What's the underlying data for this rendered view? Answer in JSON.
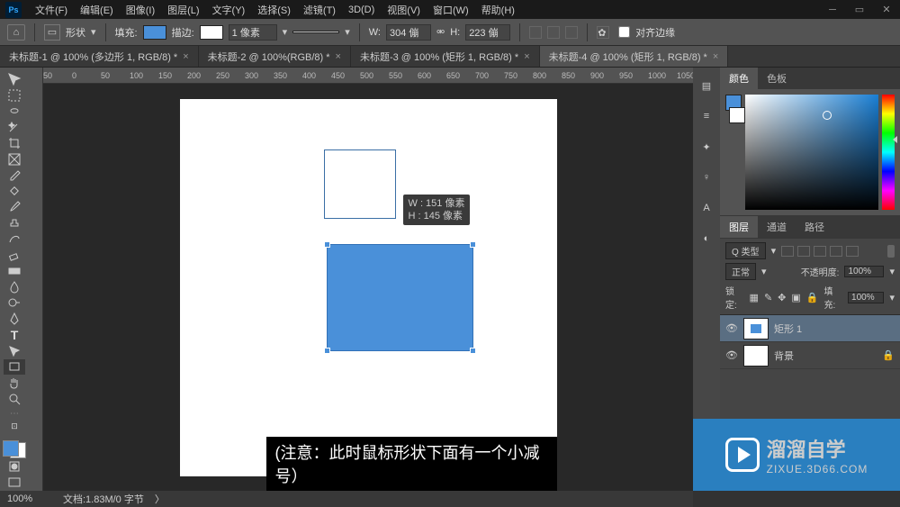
{
  "app": {
    "logo": "Ps"
  },
  "menu": {
    "file": "文件(F)",
    "edit": "编辑(E)",
    "image": "图像(I)",
    "layer": "图层(L)",
    "type": "文字(Y)",
    "select": "选择(S)",
    "filter": "滤镜(T)",
    "threeD": "3D(D)",
    "view": "视图(V)",
    "window": "窗口(W)",
    "help": "帮助(H)"
  },
  "options": {
    "shape_label": "形状",
    "fill_label": "填充:",
    "stroke_label": "描边:",
    "stroke_value": "1 像素",
    "w_label": "W:",
    "w_value": "304 傰",
    "link_icon": "link-icon",
    "h_label": "H:",
    "h_value": "223 傰",
    "align_label": "对齐边缘",
    "fill_color": "#4a90d9",
    "stroke_color": "#ffffff"
  },
  "tabs": [
    {
      "label": "未标题-1 @ 100% (多边形 1, RGB/8) *",
      "active": false
    },
    {
      "label": "未标题-2 @ 100%(RGB/8) *",
      "active": false
    },
    {
      "label": "未标题-3 @ 100% (矩形 1, RGB/8) *",
      "active": false
    },
    {
      "label": "未标题-4 @ 100% (矩形 1, RGB/8) *",
      "active": true
    }
  ],
  "ruler_marks": [
    "50",
    "0",
    "50",
    "100",
    "150",
    "200",
    "250",
    "300",
    "350",
    "400",
    "450",
    "500",
    "550",
    "600",
    "650",
    "700",
    "750",
    "800",
    "850",
    "900",
    "950",
    "1000",
    "1050"
  ],
  "tooltip": {
    "w": "W : 151 像素",
    "h": "H : 145 像素"
  },
  "subtitle": "(注意：此时鼠标形状下面有一个小减号）",
  "panels": {
    "color_tab": "颜色",
    "swatches_tab": "色板",
    "layers_tab": "图层",
    "channels_tab": "通道",
    "paths_tab": "路径",
    "kind_label": "Q 类型",
    "blend_mode": "正常",
    "opacity_label": "不透明度:",
    "opacity_value": "100%",
    "lock_label": "锁定:",
    "fill_label": "填充:",
    "fill_value": "100%"
  },
  "layers": [
    {
      "name": "矩形 1",
      "type": "shape",
      "active": true
    },
    {
      "name": "背景",
      "type": "bg",
      "active": false,
      "locked": true
    }
  ],
  "status": {
    "zoom": "100%",
    "doc_info": "文档:1.83M/0 字节"
  },
  "watermark": {
    "title": "溜溜自学",
    "url": "ZIXUE.3D66.COM"
  }
}
